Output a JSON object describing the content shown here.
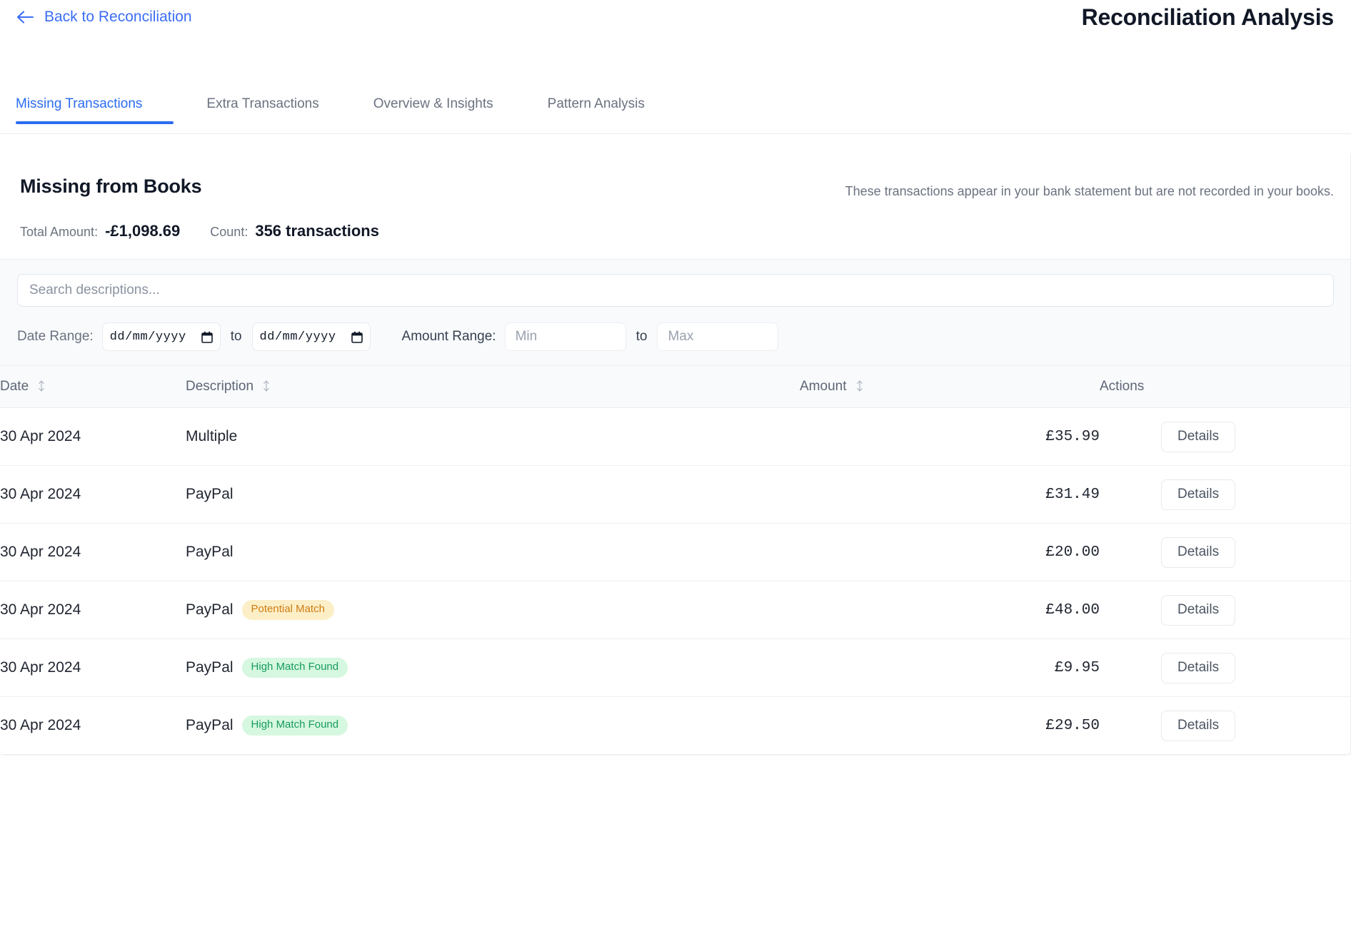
{
  "header": {
    "back_label": "Back to Reconciliation",
    "back_icon": "arrow-left-icon",
    "title": "Reconciliation Analysis"
  },
  "tabs": [
    {
      "label": "Missing Transactions",
      "active": true
    },
    {
      "label": "Extra Transactions",
      "active": false
    },
    {
      "label": "Overview & Insights",
      "active": false
    },
    {
      "label": "Pattern Analysis",
      "active": false
    }
  ],
  "section": {
    "title": "Missing from Books",
    "description": "These transactions appear in your bank statement but are not recorded in your books.",
    "total_amount_label": "Total Amount:",
    "total_amount_value": "-£1,098.69",
    "count_label": "Count:",
    "count_value": "356 transactions"
  },
  "filters": {
    "search_placeholder": "Search descriptions...",
    "search_value": "",
    "date_range_label": "Date Range:",
    "date_from_value": "dd/mm/yyyy",
    "date_to_value": "dd/mm/yyyy",
    "to_label": "to",
    "amount_range_label": "Amount Range:",
    "amount_min_placeholder": "Min",
    "amount_min_value": "",
    "amount_max_placeholder": "Max",
    "amount_max_value": "",
    "amount_to_label": "to"
  },
  "table": {
    "columns": [
      {
        "label": "Date",
        "sortable": true
      },
      {
        "label": "Description",
        "sortable": true
      },
      {
        "label": "Amount",
        "sortable": true
      },
      {
        "label": "Actions",
        "sortable": false
      }
    ],
    "action_label": "Details",
    "rows": [
      {
        "date": "30 Apr 2024",
        "description": "Multiple",
        "badge": "",
        "badge_type": "",
        "amount": "£35.99"
      },
      {
        "date": "30 Apr 2024",
        "description": "PayPal",
        "badge": "",
        "badge_type": "",
        "amount": "£31.49"
      },
      {
        "date": "30 Apr 2024",
        "description": "PayPal",
        "badge": "",
        "badge_type": "",
        "amount": "£20.00"
      },
      {
        "date": "30 Apr 2024",
        "description": "PayPal",
        "badge": "Potential Match",
        "badge_type": "potential",
        "amount": "£48.00"
      },
      {
        "date": "30 Apr 2024",
        "description": "PayPal",
        "badge": "High Match Found",
        "badge_type": "high",
        "amount": "£9.95"
      },
      {
        "date": "30 Apr 2024",
        "description": "PayPal",
        "badge": "High Match Found",
        "badge_type": "high",
        "amount": "£29.50"
      }
    ]
  },
  "colors": {
    "accent": "#2b6cf0",
    "link": "#3b6ef5",
    "amount_positive": "#0d9265",
    "badge_potential_bg": "#fcefc7",
    "badge_potential_fg": "#cf7c12",
    "badge_high_bg": "#d6f7e0",
    "badge_high_fg": "#169c5b",
    "filter_bg": "#f8fafc"
  }
}
